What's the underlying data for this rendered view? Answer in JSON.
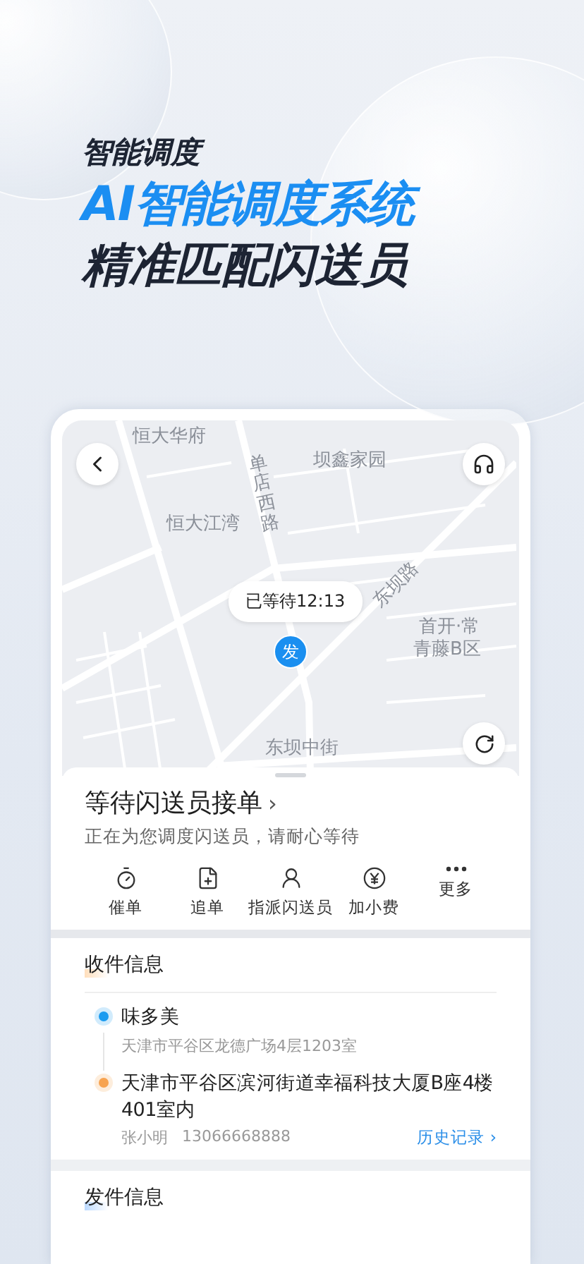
{
  "headline": {
    "eyebrow": "智能调度",
    "title": "AI智能调度系统",
    "subtitle": "精准匹配闪送员"
  },
  "map": {
    "labels": [
      {
        "text": "恒大华府",
        "kind": "area"
      },
      {
        "text": "坝鑫家园",
        "kind": "area"
      },
      {
        "text": "单店西路",
        "kind": "road-vertical"
      },
      {
        "text": "恒大江湾",
        "kind": "area"
      },
      {
        "text": "东坝路",
        "kind": "road-diagonal"
      },
      {
        "text": "首开·常",
        "kind": "area"
      },
      {
        "text": "青藤B区",
        "kind": "area"
      },
      {
        "text": "东坝中街",
        "kind": "road"
      }
    ],
    "wait_bubble": "已等待12:13",
    "pin": "发"
  },
  "order": {
    "title": "等待闪送员接单",
    "chevron": "›",
    "subtitle": "正在为您调度闪送员，请耐心等待",
    "actions": [
      {
        "label": "催单",
        "kind": "timer"
      },
      {
        "label": "追单",
        "kind": "note"
      },
      {
        "label": "指派闪送员",
        "kind": "person"
      },
      {
        "label": "加小费",
        "kind": "yen"
      },
      {
        "label": "更多",
        "kind": "more"
      }
    ]
  },
  "receiver": {
    "heading": "收件信息",
    "stops": [
      {
        "name": "味多美",
        "detail": "天津市平谷区龙德广场4层1203室",
        "color": "#1a9bf0"
      },
      {
        "name": "天津市平谷区滨河街道幸福科技大厦B座4楼401室内",
        "contact": "张小明",
        "phone": "13066668888",
        "color": "#f7a350"
      }
    ],
    "history_link": "历史记录 ›"
  },
  "sender": {
    "heading": "发件信息"
  }
}
